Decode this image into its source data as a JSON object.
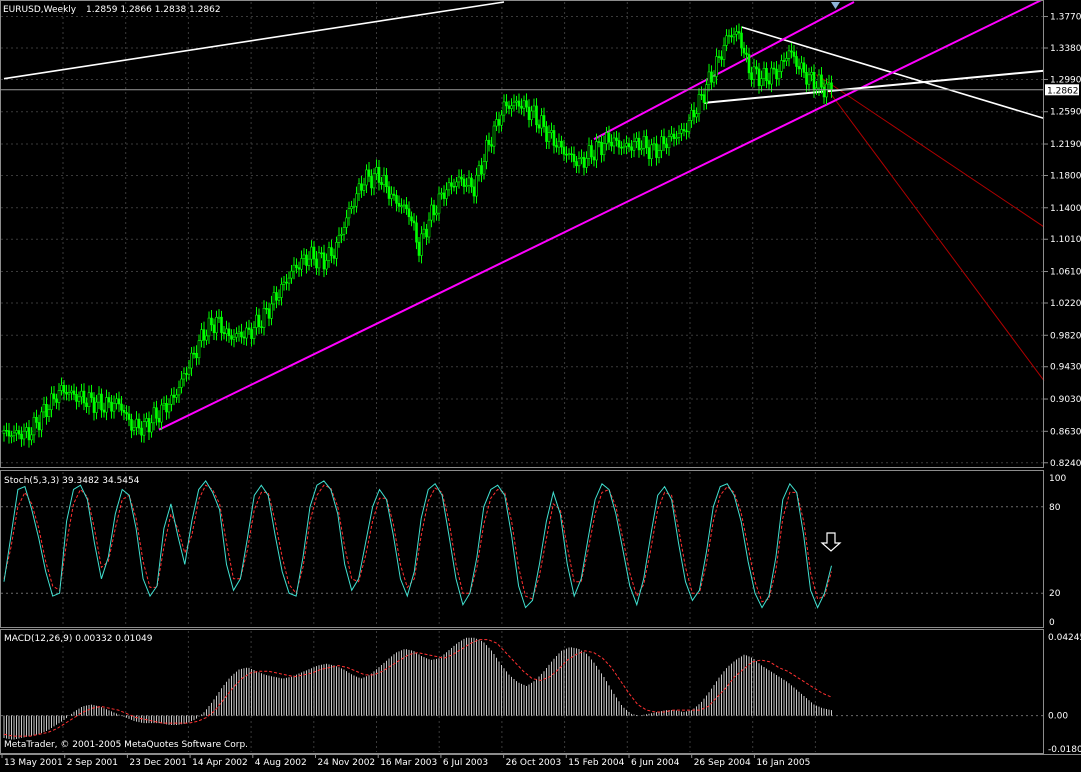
{
  "chart_data": {
    "type": "candlestick",
    "symbol_label": "EURUSD,Weekly",
    "ohlc_label": "1.2859 1.2866 1.2838 1.2862",
    "last_price_label": "1.2862",
    "last_price": 1.2862,
    "colors": {
      "background": "#000000",
      "grid": "#3a3a3a",
      "candle": "#00ff00",
      "channel": "#ff00ff",
      "trendline": "#ffffff",
      "projection": "#b00000",
      "stoch_main": "#40e0d0",
      "stoch_signal": "#ff3030",
      "macd_hist": "#c8c8c8",
      "macd_signal": "#ff3030"
    },
    "price_axis": {
      "min": 0.82,
      "max": 1.395,
      "ticks": [
        "1.3770",
        "1.3380",
        "1.2990",
        "1.2590",
        "1.2190",
        "1.1800",
        "1.1400",
        "1.1010",
        "1.0610",
        "1.0220",
        "0.9820",
        "0.9430",
        "0.9030",
        "0.8630",
        "0.8240"
      ]
    },
    "x_labels": [
      "13 May 2001",
      "2 Sep 2001",
      "23 Dec 2001",
      "14 Apr 2002",
      "4 Aug 2002",
      "24 Nov 2002",
      "16 Mar 2003",
      "6 Jul 2003",
      "26 Oct 2003",
      "15 Feb 2004",
      "6 Jun 2004",
      "26 Sep 2004",
      "16 Jan 2005"
    ],
    "price_anchors": [
      [
        0,
        0.86
      ],
      [
        10,
        0.86
      ],
      [
        18,
        0.895
      ],
      [
        23,
        0.915
      ],
      [
        30,
        0.905
      ],
      [
        40,
        0.895
      ],
      [
        46,
        0.898
      ],
      [
        51,
        0.87
      ],
      [
        56,
        0.868
      ],
      [
        62,
        0.885
      ],
      [
        68,
        0.905
      ],
      [
        74,
        0.945
      ],
      [
        80,
        0.985
      ],
      [
        85,
        1.0
      ],
      [
        90,
        0.98
      ],
      [
        98,
        0.985
      ],
      [
        104,
        1.005
      ],
      [
        110,
        1.035
      ],
      [
        116,
        1.065
      ],
      [
        122,
        1.08
      ],
      [
        128,
        1.075
      ],
      [
        132,
        1.085
      ],
      [
        138,
        1.135
      ],
      [
        144,
        1.175
      ],
      [
        150,
        1.18
      ],
      [
        156,
        1.15
      ],
      [
        162,
        1.135
      ],
      [
        166,
        1.09
      ],
      [
        170,
        1.125
      ],
      [
        176,
        1.16
      ],
      [
        182,
        1.175
      ],
      [
        188,
        1.165
      ],
      [
        194,
        1.22
      ],
      [
        200,
        1.265
      ],
      [
        206,
        1.27
      ],
      [
        212,
        1.255
      ],
      [
        218,
        1.23
      ],
      [
        224,
        1.21
      ],
      [
        230,
        1.195
      ],
      [
        236,
        1.21
      ],
      [
        242,
        1.225
      ],
      [
        248,
        1.215
      ],
      [
        254,
        1.22
      ],
      [
        260,
        1.21
      ],
      [
        266,
        1.225
      ],
      [
        272,
        1.235
      ],
      [
        278,
        1.27
      ],
      [
        284,
        1.31
      ],
      [
        290,
        1.355
      ],
      [
        294,
        1.355
      ],
      [
        298,
        1.31
      ],
      [
        304,
        1.3
      ],
      [
        310,
        1.31
      ],
      [
        314,
        1.335
      ],
      [
        318,
        1.315
      ],
      [
        322,
        1.3
      ],
      [
        327,
        1.29
      ],
      [
        331,
        1.286
      ]
    ],
    "channel_lines": [
      {
        "from": [
          62,
          0.865
        ],
        "to": [
          420,
          1.405
        ]
      },
      {
        "from": [
          236,
          1.225
        ],
        "to": [
          340,
          1.395
        ]
      },
      {
        "from": [
          280,
          1.27
        ],
        "to": [
          420,
          1.311
        ]
      }
    ],
    "trend_lines": [
      {
        "from": [
          0,
          1.3
        ],
        "to": [
          200,
          1.395
        ]
      },
      {
        "from": [
          295,
          1.364
        ],
        "to": [
          420,
          1.247
        ]
      }
    ],
    "projection_lines": [
      {
        "from": [
          325,
          1.305
        ],
        "to": [
          420,
          1.108
        ]
      },
      {
        "from": [
          325,
          1.305
        ],
        "to": [
          420,
          0.909
        ]
      }
    ],
    "stochastic": {
      "label": "Stoch(5,3,3) 39.3482 34.5454",
      "min": 0,
      "max": 100,
      "levels": [
        80,
        20
      ],
      "ticks": [
        "100",
        "80",
        "20",
        "0"
      ],
      "main": [
        28,
        60,
        92,
        94,
        78,
        58,
        35,
        18,
        20,
        70,
        92,
        95,
        85,
        55,
        30,
        45,
        75,
        92,
        88,
        65,
        30,
        18,
        25,
        65,
        82,
        60,
        40,
        70,
        92,
        98,
        90,
        78,
        40,
        22,
        30,
        58,
        88,
        95,
        88,
        60,
        35,
        20,
        18,
        45,
        80,
        95,
        98,
        92,
        75,
        40,
        22,
        30,
        55,
        80,
        92,
        85,
        60,
        30,
        18,
        35,
        72,
        92,
        96,
        88,
        60,
        30,
        12,
        20,
        45,
        80,
        92,
        95,
        88,
        60,
        25,
        10,
        15,
        40,
        70,
        90,
        75,
        40,
        18,
        30,
        58,
        85,
        96,
        92,
        75,
        50,
        25,
        12,
        30,
        60,
        88,
        94,
        85,
        55,
        28,
        15,
        22,
        48,
        80,
        94,
        96,
        88,
        70,
        42,
        20,
        10,
        18,
        45,
        85,
        96,
        90,
        60,
        22,
        10,
        20,
        39
      ],
      "signal": [
        30,
        52,
        80,
        90,
        82,
        65,
        42,
        25,
        22,
        55,
        82,
        92,
        87,
        65,
        38,
        42,
        65,
        85,
        88,
        72,
        42,
        24,
        24,
        52,
        75,
        65,
        48,
        60,
        85,
        95,
        92,
        82,
        55,
        30,
        30,
        50,
        78,
        90,
        90,
        70,
        45,
        26,
        20,
        38,
        70,
        88,
        95,
        93,
        80,
        52,
        30,
        28,
        46,
        70,
        86,
        86,
        68,
        40,
        24,
        30,
        60,
        84,
        93,
        90,
        70,
        40,
        20,
        20,
        38,
        68,
        86,
        92,
        90,
        70,
        38,
        18,
        16,
        32,
        58,
        82,
        78,
        52,
        28,
        28,
        50,
        75,
        90,
        92,
        80,
        58,
        34,
        18,
        26,
        50,
        78,
        90,
        88,
        65,
        38,
        20,
        20,
        40,
        70,
        88,
        94,
        90,
        76,
        52,
        28,
        14,
        16,
        36,
        72,
        90,
        90,
        70,
        34,
        16,
        18,
        35
      ]
    },
    "macd": {
      "label": "MACD(12,26,9) 0.00332 0.01049",
      "min": -0.0185,
      "max": 0.0435,
      "ticks": [
        "0.04245",
        "0.00",
        "-0.0180"
      ],
      "hist": [
        -0.012,
        -0.013,
        -0.012,
        -0.011,
        -0.01,
        -0.008,
        -0.005,
        -0.002,
        0.002,
        0.005,
        0.006,
        0.005,
        0.003,
        0.001,
        -0.001,
        -0.003,
        -0.004,
        -0.004,
        -0.004,
        -0.005,
        -0.005,
        -0.004,
        -0.002,
        0.002,
        0.008,
        0.015,
        0.021,
        0.025,
        0.026,
        0.024,
        0.022,
        0.021,
        0.02,
        0.021,
        0.023,
        0.025,
        0.027,
        0.028,
        0.027,
        0.025,
        0.022,
        0.02,
        0.022,
        0.026,
        0.03,
        0.034,
        0.036,
        0.035,
        0.032,
        0.03,
        0.031,
        0.035,
        0.039,
        0.042,
        0.042,
        0.04,
        0.035,
        0.028,
        0.022,
        0.018,
        0.016,
        0.019,
        0.024,
        0.03,
        0.035,
        0.037,
        0.036,
        0.033,
        0.027,
        0.02,
        0.012,
        0.005,
        0.001,
        0.0,
        0.001,
        0.002,
        0.003,
        0.003,
        0.002,
        0.003,
        0.007,
        0.013,
        0.02,
        0.026,
        0.03,
        0.033,
        0.031,
        0.027,
        0.024,
        0.021,
        0.018,
        0.014,
        0.01,
        0.006,
        0.004,
        0.003
      ],
      "signal": [
        -0.01,
        -0.011,
        -0.011,
        -0.011,
        -0.01,
        -0.009,
        -0.007,
        -0.004,
        -0.001,
        0.002,
        0.004,
        0.005,
        0.004,
        0.003,
        0.001,
        -0.001,
        -0.002,
        -0.003,
        -0.004,
        -0.004,
        -0.004,
        -0.004,
        -0.003,
        -0.001,
        0.003,
        0.009,
        0.015,
        0.02,
        0.023,
        0.024,
        0.024,
        0.023,
        0.022,
        0.021,
        0.022,
        0.023,
        0.025,
        0.026,
        0.027,
        0.026,
        0.024,
        0.022,
        0.022,
        0.024,
        0.027,
        0.03,
        0.033,
        0.034,
        0.033,
        0.032,
        0.031,
        0.033,
        0.036,
        0.039,
        0.041,
        0.041,
        0.039,
        0.034,
        0.029,
        0.024,
        0.02,
        0.019,
        0.021,
        0.025,
        0.03,
        0.033,
        0.035,
        0.034,
        0.031,
        0.026,
        0.019,
        0.012,
        0.006,
        0.003,
        0.002,
        0.002,
        0.003,
        0.003,
        0.003,
        0.003,
        0.005,
        0.01,
        0.015,
        0.021,
        0.025,
        0.029,
        0.03,
        0.029,
        0.026,
        0.024,
        0.021,
        0.018,
        0.015,
        0.012,
        0.01
      ]
    },
    "copyright": "MetaTrader, © 2001-2005 MetaQuotes Software Corp."
  }
}
